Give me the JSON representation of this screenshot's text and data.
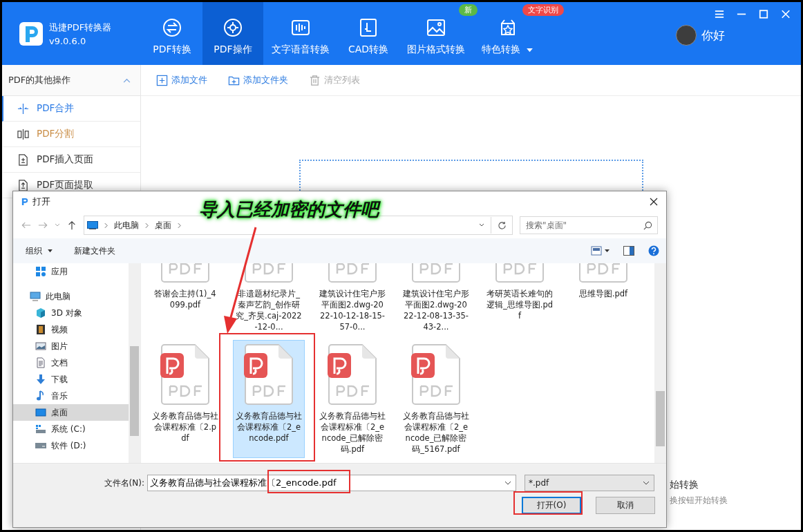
{
  "app": {
    "name": "迅捷PDF转换器",
    "version": "v9.0.6.0"
  },
  "nav_tabs": [
    {
      "label": "PDF转换",
      "kind": "convert",
      "selected": false
    },
    {
      "label": "PDF操作",
      "kind": "operate",
      "selected": true
    },
    {
      "label": "文字语音转换",
      "kind": "audio",
      "selected": false
    },
    {
      "label": "CAD转换",
      "kind": "cad",
      "selected": false
    },
    {
      "label": "图片格式转换",
      "kind": "image",
      "selected": false,
      "badge": {
        "text": "新",
        "color": "#5cb946"
      }
    },
    {
      "label": "特色转换",
      "kind": "special",
      "selected": false,
      "dropdown": true,
      "badge": {
        "text": "文字识别",
        "color": "#f04848"
      }
    }
  ],
  "user": {
    "name": "你好"
  },
  "sidebar": {
    "title": "PDF的其他操作",
    "expanded": true,
    "items": [
      {
        "label": "PDF合并",
        "kind": "merge",
        "selected": true,
        "hovered": false
      },
      {
        "label": "PDF分割",
        "kind": "split",
        "selected": false,
        "hovered": true
      },
      {
        "label": "PDF插入页面",
        "kind": "insert",
        "selected": false,
        "hovered": false
      },
      {
        "label": "PDF页面提取",
        "kind": "extract",
        "selected": false,
        "hovered": false
      }
    ]
  },
  "toolbar": [
    {
      "label": "添加文件",
      "kind": "file",
      "disabled": false
    },
    {
      "label": "添加文件夹",
      "kind": "folder",
      "disabled": false
    },
    {
      "label": "清空列表",
      "kind": "trash",
      "disabled": true
    }
  ],
  "hint": {
    "title": "始转换",
    "text": "换按钮开始转换"
  },
  "dialog": {
    "title": "打开",
    "path": [
      "此电脑",
      "桌面"
    ],
    "search": {
      "placeholder": "搜索\"桌面\""
    },
    "commands": [
      {
        "label": "组织",
        "dropdown": true
      },
      {
        "label": "新建文件夹",
        "dropdown": false
      }
    ],
    "nav": [
      {
        "label": "应用",
        "kind": "apps",
        "selected": false
      },
      {
        "label": "此电脑",
        "kind": "pc",
        "selected": false,
        "children": [
          {
            "label": "3D 对象",
            "kind": "cube",
            "selected": false
          },
          {
            "label": "视频",
            "kind": "video",
            "selected": false
          },
          {
            "label": "图片",
            "kind": "picture",
            "selected": false
          },
          {
            "label": "文档",
            "kind": "doc",
            "selected": false
          },
          {
            "label": "下载",
            "kind": "download",
            "selected": false
          },
          {
            "label": "音乐",
            "kind": "music",
            "selected": false
          },
          {
            "label": "桌面",
            "kind": "desktop",
            "selected": true
          },
          {
            "label": "系统 (C:)",
            "kind": "system-drive",
            "selected": false
          },
          {
            "label": "软件 (D:)",
            "kind": "drive",
            "selected": false
          }
        ]
      }
    ],
    "files": [
      {
        "name": "答谢会主持(1)_4099.pdf",
        "kind": "plain",
        "selected": false
      },
      {
        "name": "非遗题材纪录片_秦声艺韵_创作研究_齐昊.caj-2022-12-0...",
        "kind": "plain",
        "selected": false
      },
      {
        "name": "建筑设计住宅户形平面图2.dwg-2022-10-12-18-15-57-0...",
        "kind": "plain",
        "selected": false
      },
      {
        "name": "建筑设计住宅户形平面图2.dwg-2022-12-08-13-35-43-2...",
        "kind": "plain",
        "selected": false
      },
      {
        "name": "考研英语长难句的逻辑_思维导图.pdf",
        "kind": "plain",
        "selected": false
      },
      {
        "name": "思维导图.pdf",
        "kind": "plain",
        "selected": false
      },
      {
        "name": "义务教育品德与社会课程标准〔2.pdf",
        "kind": "app",
        "selected": false
      },
      {
        "name": "义务教育品德与社会课程标准〔2_encode.pdf",
        "kind": "app",
        "selected": true
      },
      {
        "name": "义务教育品德与社会课程标准〔2_encode_已解除密码.pdf",
        "kind": "app",
        "selected": false
      },
      {
        "name": "义务教育品德与社会课程标准〔2_encode_已解除密码_5167.pdf",
        "kind": "app",
        "selected": false
      }
    ],
    "filename_label": "文件名(N):",
    "filename": "义务教育品德与社会课程标准〔2_encode.pdf",
    "filter": "*.pdf",
    "buttons": [
      {
        "label": "打开(O)",
        "primary": true
      },
      {
        "label": "取消",
        "primary": false
      }
    ]
  },
  "annotation": {
    "caption": "导入已经加密的文件吧"
  }
}
